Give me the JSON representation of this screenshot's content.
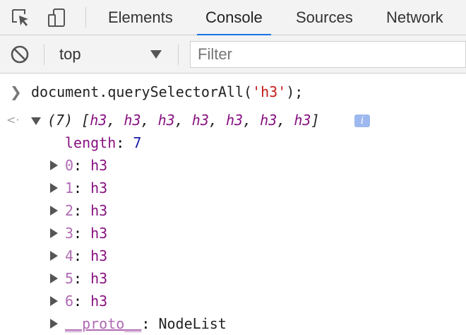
{
  "tabs": {
    "items": [
      "Elements",
      "Console",
      "Sources",
      "Network"
    ],
    "active": "Console"
  },
  "toolbar": {
    "context": "top",
    "filter_placeholder": "Filter"
  },
  "console": {
    "command_prefix": "document.querySelectorAll(",
    "command_arg": "'h3'",
    "command_suffix": ");",
    "result": {
      "count_label": "(7)",
      "summary_open": "[",
      "summary_items": [
        "h3",
        "h3",
        "h3",
        "h3",
        "h3",
        "h3",
        "h3"
      ],
      "summary_close": "]",
      "info_badge": "i",
      "length_key": "length",
      "length_value": "7",
      "entries": [
        {
          "key": "0",
          "value": "h3"
        },
        {
          "key": "1",
          "value": "h3"
        },
        {
          "key": "2",
          "value": "h3"
        },
        {
          "key": "3",
          "value": "h3"
        },
        {
          "key": "4",
          "value": "h3"
        },
        {
          "key": "5",
          "value": "h3"
        },
        {
          "key": "6",
          "value": "h3"
        }
      ],
      "proto_key": "__proto__",
      "proto_value": "NodeList"
    }
  },
  "colors": {
    "accent": "#1a73e8",
    "string": "#c41a16",
    "element": "#881280",
    "number": "#1a1aa6"
  },
  "icons": {
    "inspect": "inspect-element-icon",
    "device": "device-toolbar-icon",
    "clear": "clear-console-icon"
  }
}
